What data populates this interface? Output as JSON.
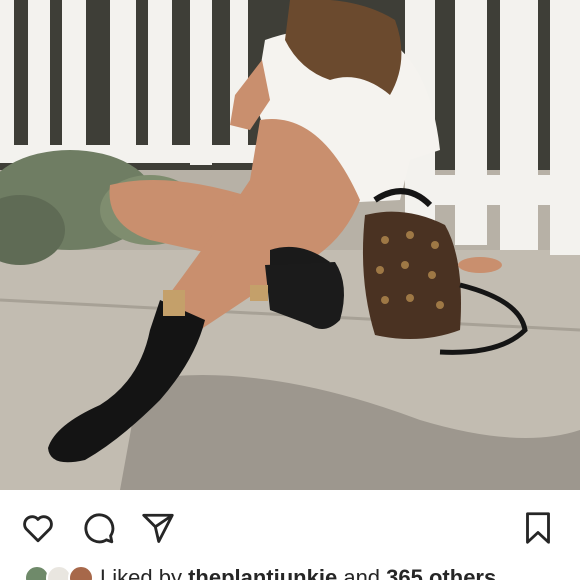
{
  "post": {
    "image_alt": "Woman in white shirt and black ankle boots sitting on pavement beside a white picket fence with a monogram mini backpack"
  },
  "actions": {
    "like": "heart-icon",
    "comment": "comment-bubble-icon",
    "share": "paper-plane-icon",
    "save": "bookmark-icon"
  },
  "likes": {
    "prefix": "Liked by",
    "user": "theplantjunkie",
    "conjunction": "and",
    "others": "365 others"
  },
  "colors": {
    "icon": "#262626",
    "text": "#262626",
    "background": "#ffffff"
  }
}
